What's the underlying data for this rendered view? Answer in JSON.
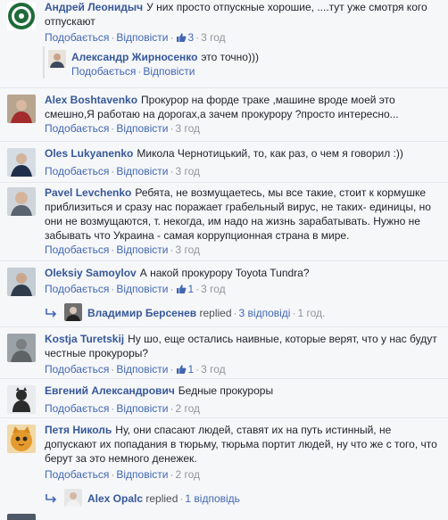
{
  "comments": [
    {
      "author": "Андрей Леонидыч",
      "text": "У них просто отпускные хорошие, ....тут уже смотря кого отпускают",
      "like": "Подобається",
      "reply": "Відповісти",
      "likes": "3",
      "time": "3 год",
      "reply_item": {
        "author": "Александр Жирносенко",
        "text": "это точно)))",
        "like": "Подобається",
        "reply": "Відповісти"
      }
    },
    {
      "author": "Alex Boshtavenko",
      "text": "Прокурор на форде траке ,машине вроде моей это смешно,Я работаю на дорогах,а зачем прокурору ?просто интересно...",
      "like": "Подобається",
      "reply": "Відповісти",
      "time": "3 год"
    },
    {
      "author": "Oles Lukyanenko",
      "text": "Микола Чернотицький, то, как раз, о чем я говорил :))",
      "like": "Подобається",
      "reply": "Відповісти",
      "time": "3 год"
    },
    {
      "author": "Pavel Levchenko",
      "text": "Ребята, не возмущаетесь, мы все такие, стоит к кормушке приблизиться и сразу нас поражает грабельный вирус, не таких- единицы, но они не возмущаются, т. некогда, им надо на жизнь зарабатывать. Нужно не забывать что Украина - самая коррупционная страна в мире.",
      "like": "Подобається",
      "reply": "Відповісти",
      "time": "3 год"
    },
    {
      "author": "Oleksiy Samoylov",
      "text": "А накой прокурору Toyota Tundra?",
      "like": "Подобається",
      "reply": "Відповісти",
      "likes": "1",
      "time": "3 год",
      "replies_summary": {
        "author": "Владимир Берсенев",
        "replied": "replied",
        "count": "3 відповіді",
        "time": "1 год."
      }
    },
    {
      "author": "Kostja Turetskij",
      "text": "Ну шо, еще остались наивные, которые верят, что у нас будут честные прокуроры?",
      "like": "Подобається",
      "reply": "Відповісти",
      "likes": "1",
      "time": "3 год"
    },
    {
      "author": "Евгений Александрович",
      "text": "Бедные прокуроры",
      "like": "Подобається",
      "reply": "Відповісти",
      "time": "2 год"
    },
    {
      "author": "Петя Николь",
      "text": "Ну, они спасают людей, ставят их на путь истинный, не допускают их попадания в тюрьму, тюрьма портит людей, ну что же с того, что берут за это немного денежек.",
      "like": "Подобається",
      "reply": "Відповісти",
      "time": "2 год",
      "replies_summary": {
        "author": "Alex Opalc",
        "replied": "replied",
        "count": "1 відповідь"
      }
    }
  ],
  "colors": {
    "link": "#365899",
    "action": "#4267b2",
    "meta": "#90949c",
    "background": "#f6f7f9"
  },
  "icons": [
    "thumbs-up-icon",
    "reply-arrow-icon"
  ]
}
